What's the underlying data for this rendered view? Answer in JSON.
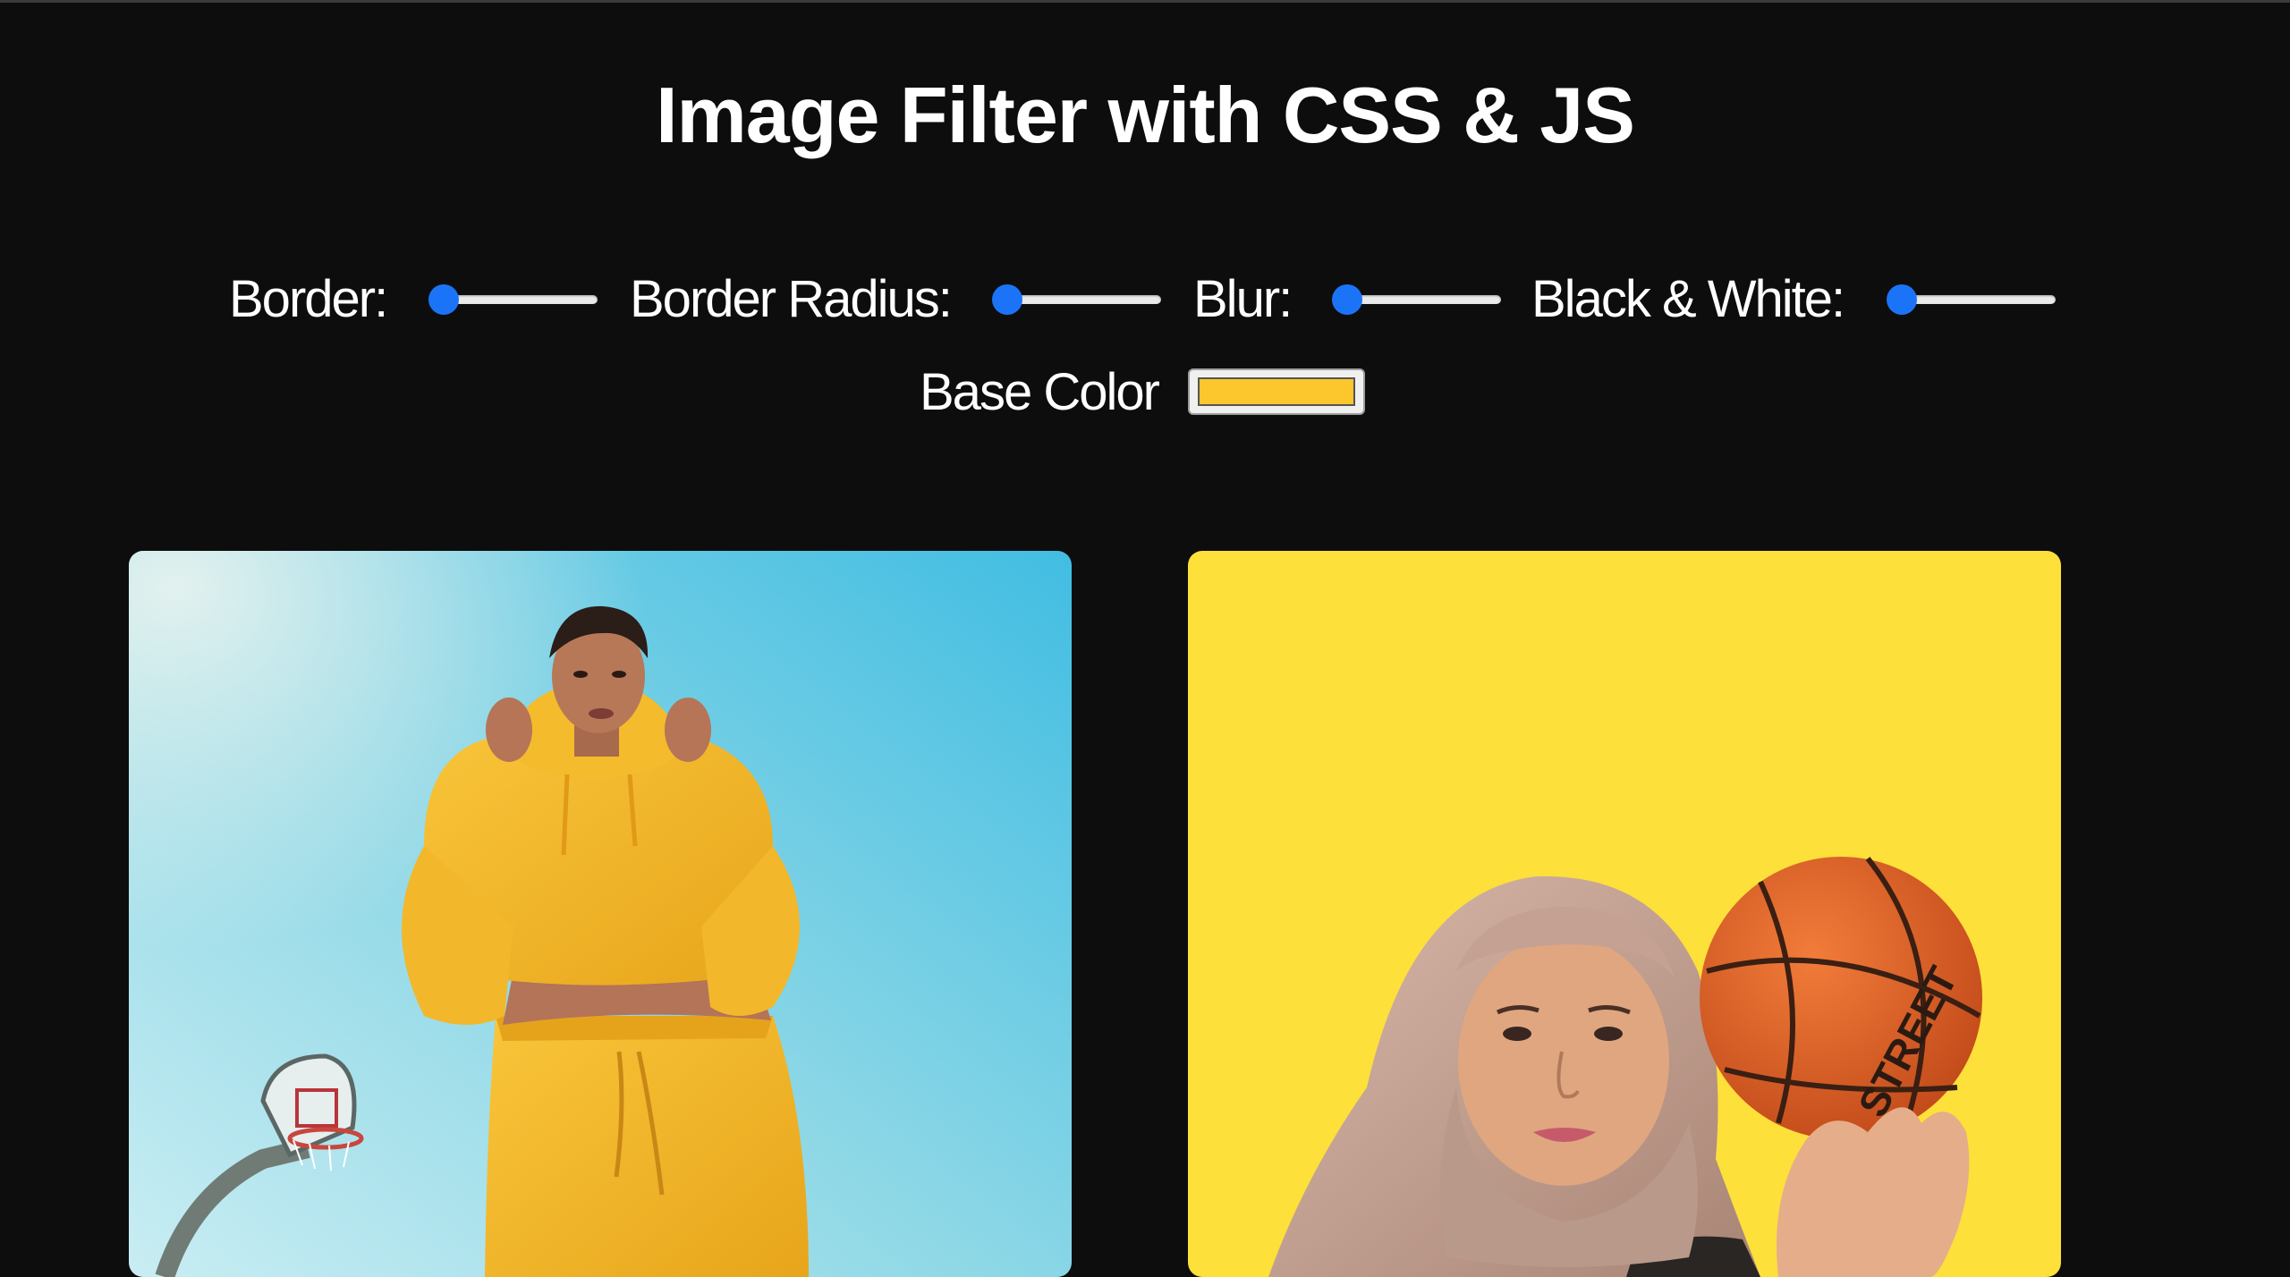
{
  "page": {
    "title": "Image Filter with CSS & JS"
  },
  "controls": {
    "border_label": "Border:",
    "border_radius_label": "Border Radius:",
    "blur_label": "Blur:",
    "bw_label": "Black & White:",
    "base_color_label": "Base Color"
  },
  "sliders": {
    "border": 0,
    "border_radius": 0,
    "blur": 0,
    "black_white": 0
  },
  "base_color": "#fcc62d",
  "colors": {
    "background": "#0d0d0e",
    "accent": "#1b74f7",
    "image2_background": "#fde03a"
  },
  "images": [
    {
      "subject": "woman in yellow hoodie under blue sky with basketball hoop"
    },
    {
      "subject": "woman in hijab holding basketball on yellow background"
    }
  ]
}
